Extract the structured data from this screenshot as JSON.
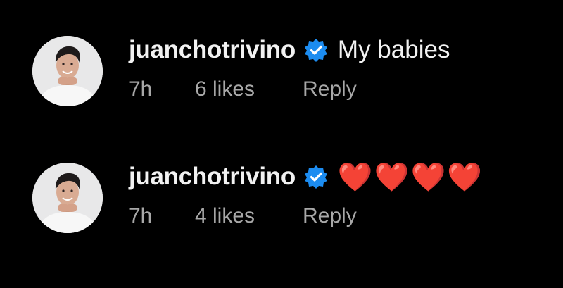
{
  "comments": [
    {
      "username": "juanchotrivino",
      "verified": true,
      "text": "My babies",
      "time": "7h",
      "likes": "6 likes",
      "reply_label": "Reply"
    },
    {
      "username": "juanchotrivino",
      "verified": true,
      "text": "❤️❤️❤️❤️",
      "time": "7h",
      "likes": "4 likes",
      "reply_label": "Reply"
    }
  ],
  "colors": {
    "background": "#000000",
    "text_primary": "#f2f2f2",
    "text_secondary": "#a8a8a8",
    "verified_badge": "#1c8cf0",
    "heart": "#e0202f"
  }
}
